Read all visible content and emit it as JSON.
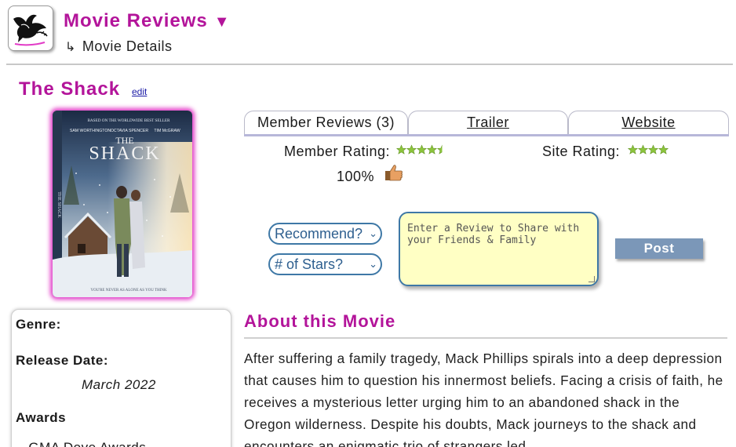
{
  "header": {
    "app_title": "Movie Reviews",
    "title_caret": "▼",
    "breadcrumb_arrow": "↳",
    "breadcrumb": "Movie Details",
    "logo_icon": "dove-icon"
  },
  "movie": {
    "title": "The Shack",
    "edit_label": "edit",
    "poster": {
      "top_line": "BASED ON THE WORLDWIDE BEST SELLER",
      "cast": [
        "SAM WORTHINGTON",
        "OCTAVIA SPENCER",
        "TIM McGRAW"
      ],
      "title_the": "THE",
      "title_main": "SHACK",
      "spine": "THE SHACK",
      "tagline": "YOU'RE NEVER AS ALONE AS YOU THINK"
    }
  },
  "tabs": [
    {
      "label": "Member Reviews (3)"
    },
    {
      "label": "Trailer"
    },
    {
      "label": "Website"
    }
  ],
  "ratings": {
    "member_label": "Member Rating:",
    "member_stars": 4.5,
    "site_label": "Site Rating:",
    "site_stars": 4,
    "percent": "100%",
    "thumb_icon": "thumbs-up-icon",
    "star_color": "#8cc43c"
  },
  "review_form": {
    "recommend_select": "Recommend?",
    "stars_select": "# of Stars?",
    "textarea_placeholder": "Enter a Review to Share with your Friends & Family",
    "post_label": "Post"
  },
  "info": {
    "genre_label": "Genre:",
    "release_label": "Release Date:",
    "release_value": "March 2022",
    "awards_label": "Awards",
    "awards": [
      "GMA Dove Awards"
    ]
  },
  "about": {
    "title": "About this Movie",
    "text": "After suffering a family tragedy, Mack Phillips spirals into a deep depression that causes him to question his innermost beliefs. Facing a crisis of faith, he receives a mysterious letter urging him to an abandoned shack in the Oregon wilderness. Despite his doubts, Mack journeys to the shack and encounters an enigmatic trio of strangers led"
  },
  "colors": {
    "accent": "#b3149a",
    "select_border": "#3e78a6",
    "post_button": "#7b97b8",
    "textarea_bg": "#ffffc4"
  }
}
